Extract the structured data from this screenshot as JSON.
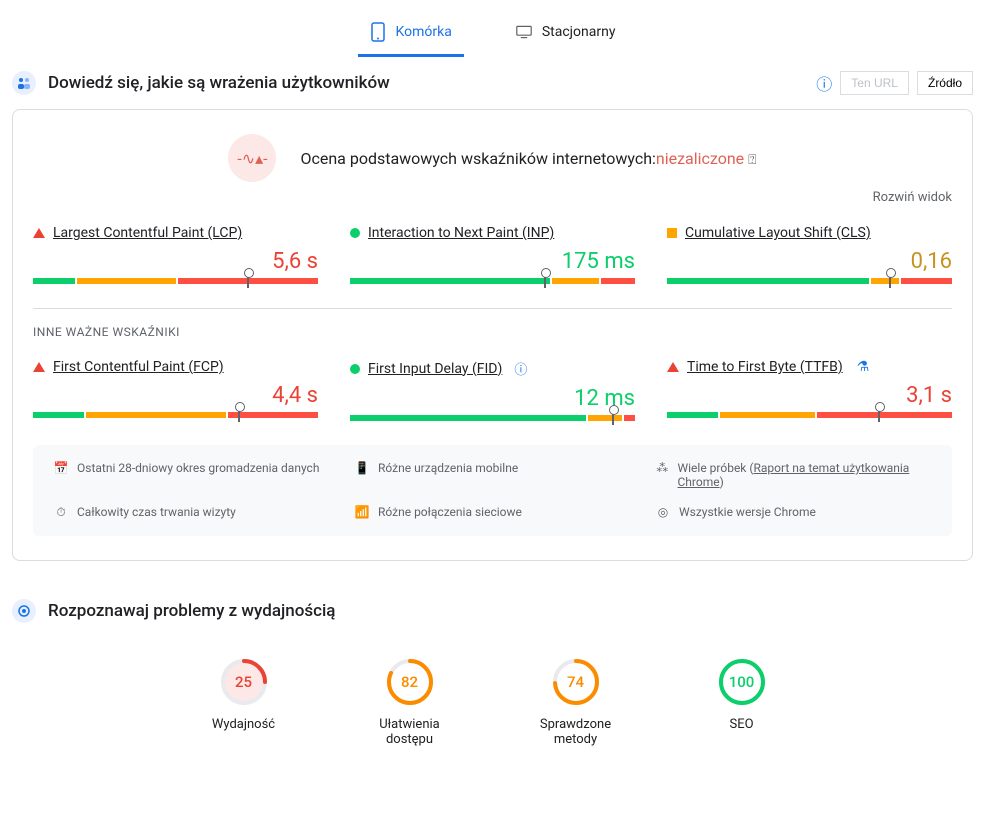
{
  "tabs": {
    "mobile": "Komórka",
    "desktop": "Stacjonarny"
  },
  "section1": {
    "title": "Dowiedź się, jakie są wrażenia użytkowników",
    "btn_url": "Ten URL",
    "btn_source": "Źródło"
  },
  "assessment": {
    "label": "Ocena podstawowych wskaźników internetowych:",
    "status": "niezaliczone",
    "expand": "Rozwiń widok"
  },
  "metrics": [
    {
      "name": "Largest Contentful Paint (LCP)",
      "value": "5,6 s",
      "status": "red",
      "indicator": "triangle-red",
      "segs": [
        15,
        35,
        50
      ],
      "marker": 75
    },
    {
      "name": "Interaction to Next Paint (INP)",
      "value": "175 ms",
      "status": "green",
      "indicator": "circle-green",
      "segs": [
        71,
        17,
        12
      ],
      "marker": 68
    },
    {
      "name": "Cumulative Layout Shift (CLS)",
      "value": "0,16",
      "status": "orange",
      "indicator": "square-orange",
      "segs": [
        72,
        10,
        18
      ],
      "marker": 78
    }
  ],
  "other_label": "INNE WAŻNE WSKAŹNIKI",
  "other_metrics": [
    {
      "name": "First Contentful Paint (FCP)",
      "value": "4,4 s",
      "status": "red",
      "indicator": "triangle-red",
      "segs": [
        18,
        50,
        32
      ],
      "marker": 72,
      "extra": ""
    },
    {
      "name": "First Input Delay (FID)",
      "value": "12 ms",
      "status": "green",
      "indicator": "circle-green",
      "segs": [
        84,
        12,
        4
      ],
      "marker": 92,
      "extra": "info"
    },
    {
      "name": "Time to First Byte (TTFB)",
      "value": "3,1 s",
      "status": "red",
      "indicator": "triangle-red",
      "segs": [
        18,
        34,
        48
      ],
      "marker": 74,
      "extra": "flask"
    }
  ],
  "footer": [
    {
      "icon": "📅",
      "text": "Ostatni 28-dniowy okres gromadzenia danych"
    },
    {
      "icon": "📱",
      "text": "Różne urządzenia mobilne"
    },
    {
      "icon": "⁂",
      "text": "Wiele próbek (",
      "link": "Raport na temat użytkowania Chrome",
      "suffix": ")"
    },
    {
      "icon": "⏱",
      "text": "Całkowity czas trwania wizyty"
    },
    {
      "icon": "📶",
      "text": "Różne połączenia sieciowe"
    },
    {
      "icon": "◎",
      "text": "Wszystkie wersje Chrome"
    }
  ],
  "section2": {
    "title": "Rozpoznawaj problemy z wydajnością"
  },
  "gauges": [
    {
      "value": "25",
      "label": "Wydajność",
      "color": "red",
      "stroke": "#ea4335",
      "fill": "#fce8e6",
      "pct": 25
    },
    {
      "value": "82",
      "label": "Ułatwienia dostępu",
      "color": "orange",
      "stroke": "#fb8c00",
      "fill": "#fff",
      "pct": 82
    },
    {
      "value": "74",
      "label": "Sprawdzone metody",
      "color": "orange",
      "stroke": "#fb8c00",
      "fill": "#fff",
      "pct": 74
    },
    {
      "value": "100",
      "label": "SEO",
      "color": "green",
      "stroke": "#0cce6b",
      "fill": "#fff",
      "pct": 100
    }
  ]
}
